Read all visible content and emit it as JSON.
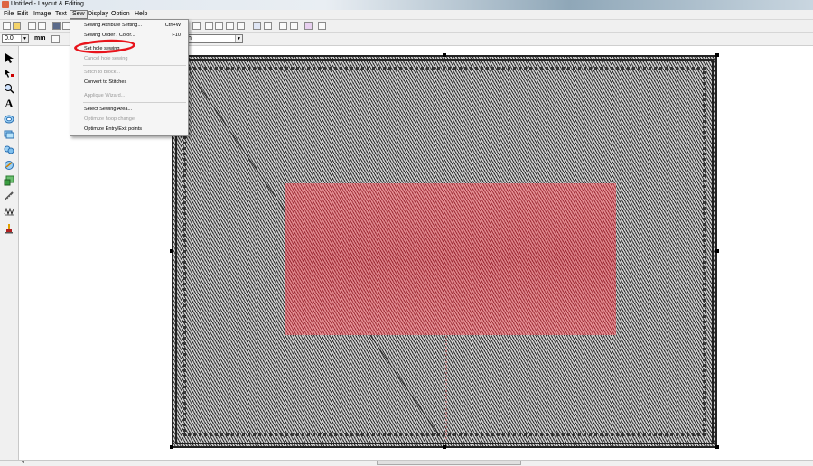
{
  "window": {
    "title": "Untitled - Layout & Editing"
  },
  "menubar": {
    "items": [
      "File",
      "Edit",
      "Image",
      "Text",
      "Sew",
      "Display",
      "Option",
      "Help"
    ],
    "active": "Sew"
  },
  "toolbar": {
    "stitch_value": "0.0",
    "unit_label": "mm",
    "font_combo_fragment": "h"
  },
  "sew_menu": {
    "items": [
      {
        "label": "Sewing Attribute Setting...",
        "shortcut": "Ctrl+W",
        "enabled": true
      },
      {
        "label": "Sewing Order / Color...",
        "shortcut": "F10",
        "enabled": true
      },
      {
        "label": "Set hole sewing",
        "shortcut": "",
        "enabled": true
      },
      {
        "label": "Cancel hole sewing",
        "shortcut": "",
        "enabled": false
      },
      {
        "label": "Stitch to Block...",
        "shortcut": "",
        "enabled": false
      },
      {
        "label": "Convert to Stitches",
        "shortcut": "",
        "enabled": true
      },
      {
        "label": "Applique Wizard...",
        "shortcut": "",
        "enabled": false
      },
      {
        "label": "Select Sewing Area...",
        "shortcut": "",
        "enabled": true
      },
      {
        "label": "Optimize hoop change",
        "shortcut": "",
        "enabled": false
      },
      {
        "label": "Optimize Entry/Exit points",
        "shortcut": "",
        "enabled": true
      }
    ],
    "highlighted_item": "Set hole sewing",
    "highlight_color": "#e8141c"
  },
  "left_tools": [
    "select-arrow-icon",
    "point-edit-icon",
    "zoom-icon",
    "text-tool-icon",
    "shape-ellipse-icon",
    "shape-rect-icon",
    "shape-circles-icon",
    "shape-stitch-icon",
    "shape-fill-icon",
    "measure-icon",
    "stitch-tool-icon",
    "brush-icon"
  ],
  "canvas": {
    "hoop_color": "#8a8a8a",
    "fill_region_color": "#cf5c64"
  }
}
